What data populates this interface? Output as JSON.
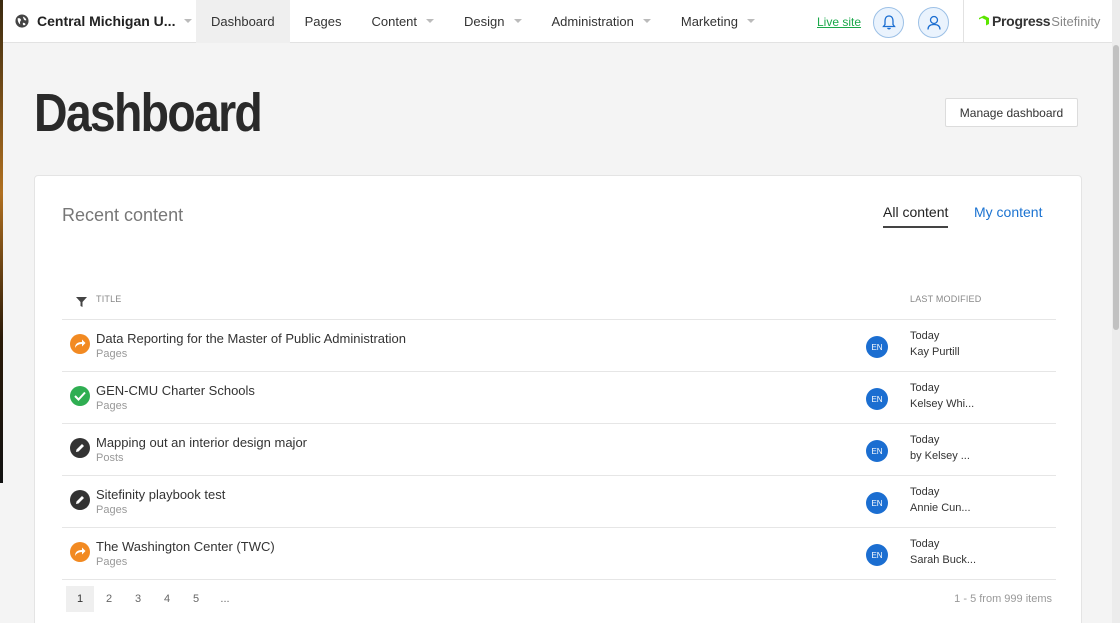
{
  "topbar": {
    "site_name": "Central Michigan U...",
    "nav": [
      {
        "label": "Dashboard",
        "active": true,
        "dropdown": false
      },
      {
        "label": "Pages",
        "active": false,
        "dropdown": false
      },
      {
        "label": "Content",
        "active": false,
        "dropdown": true
      },
      {
        "label": "Design",
        "active": false,
        "dropdown": true
      },
      {
        "label": "Administration",
        "active": false,
        "dropdown": true
      },
      {
        "label": "Marketing",
        "active": false,
        "dropdown": true
      }
    ],
    "live_site": "Live site",
    "brand_progress": "Progress",
    "brand_sitefinity": "Sitefinity"
  },
  "page": {
    "title": "Dashboard",
    "manage_button": "Manage dashboard"
  },
  "recent": {
    "title": "Recent content",
    "tabs": [
      "All content",
      "My content"
    ],
    "col_title": "TITLE",
    "col_modified": "LAST MODIFIED",
    "rows": [
      {
        "title": "Data Reporting for the Master of Public Administration",
        "type": "Pages",
        "status": "orange",
        "lang": "EN",
        "date": "Today",
        "user": "Kay Purtill"
      },
      {
        "title": "GEN-CMU Charter Schools",
        "type": "Pages",
        "status": "green",
        "lang": "EN",
        "date": "Today",
        "user": "Kelsey Whi..."
      },
      {
        "title": "Mapping out an interior design major",
        "type": "Posts",
        "status": "dark",
        "lang": "EN",
        "date": "Today",
        "user": "by Kelsey ..."
      },
      {
        "title": "Sitefinity playbook test",
        "type": "Pages",
        "status": "dark",
        "lang": "EN",
        "date": "Today",
        "user": "Annie Cun..."
      },
      {
        "title": "The Washington Center (TWC)",
        "type": "Pages",
        "status": "orange",
        "lang": "EN",
        "date": "Today",
        "user": "Sarah Buck..."
      }
    ],
    "pages": [
      "1",
      "2",
      "3",
      "4",
      "5",
      "..."
    ],
    "pager_info": "1 - 5 from 999 items"
  },
  "colors": {
    "accent_blue": "#1b73d1",
    "live_green": "#1aa84a",
    "status_orange": "#f28a22",
    "status_green": "#2fae52",
    "status_dark": "#333333"
  }
}
